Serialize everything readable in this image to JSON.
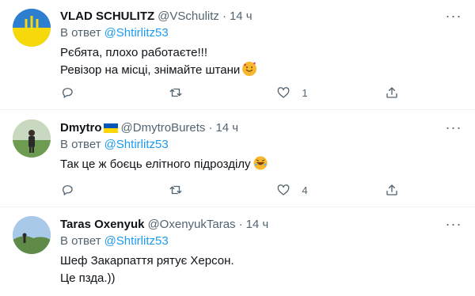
{
  "tweets": [
    {
      "display_name": "VLAD SCHULITZ",
      "handle": "@VSchulitz",
      "time": "14 ч",
      "reply_prefix": "В ответ",
      "reply_to": "@Shtirlitz53",
      "lines": [
        "Рєбята, плохо работаєте!!!",
        "Ревізор на місці, знімайте штани"
      ],
      "emoji": "smiling-face-with-hearts",
      "reply_count": "",
      "retweet_count": "",
      "like_count": "1"
    },
    {
      "display_name": "Dmytro",
      "handle": "@DmytroBurets",
      "time": "14 ч",
      "reply_prefix": "В ответ",
      "reply_to": "@Shtirlitz53",
      "lines": [
        "Так це ж боєць елітного підрозділу"
      ],
      "emoji": "rolling-on-floor-laughing",
      "reply_count": "",
      "retweet_count": "",
      "like_count": "4"
    },
    {
      "display_name": "Taras Oxenyuk",
      "handle": "@OxenyukTaras",
      "time": "14 ч",
      "reply_prefix": "В ответ",
      "reply_to": "@Shtirlitz53",
      "lines": [
        "Шеф Закарпаття рятує Херсон.",
        "Це пзда.))"
      ],
      "emoji": "",
      "reply_count": "",
      "retweet_count": "",
      "like_count": ""
    }
  ],
  "colors": {
    "accent": "#1d9bf0",
    "secondary_text": "#536471",
    "divider": "#eff3f4"
  },
  "icons": [
    "reply-icon",
    "retweet-icon",
    "like-icon",
    "share-icon",
    "more-icon"
  ]
}
